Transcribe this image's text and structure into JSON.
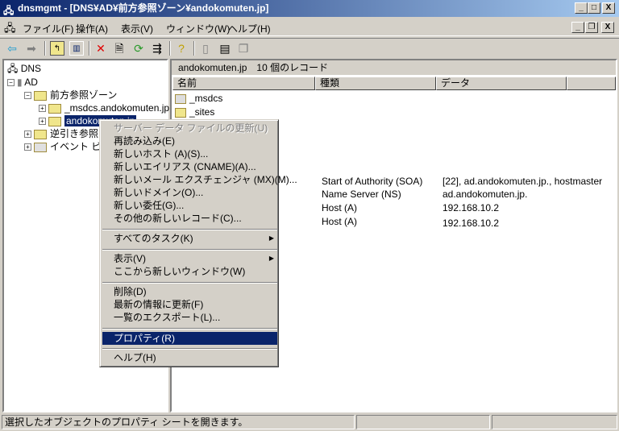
{
  "window": {
    "title": "dnsmgmt - [DNS¥AD¥前方参照ゾーン¥andokomuten.jp]",
    "minimize": "_",
    "maximize": "□",
    "close": "X",
    "mdi_min": "_",
    "mdi_restore": "❐",
    "mdi_close": "X"
  },
  "menubar": [
    "ファイル(F)",
    "操作(A)",
    "表示(V)",
    "ウィンドウ(W)",
    "ヘルプ(H)"
  ],
  "tree": {
    "root": "DNS",
    "server": "AD",
    "forward": "前方参照ゾーン",
    "zone1": "_msdcs.andokomuten.jp",
    "zone2": "andokomuten.jp",
    "reverse": "逆引き参照ゾーン",
    "events": "イベント ビューア"
  },
  "right": {
    "header": "andokomuten.jp　10 個のレコード",
    "columns": [
      "名前",
      "種類",
      "データ"
    ],
    "rows": [
      {
        "name": "_msdcs",
        "type": "",
        "data": ""
      },
      {
        "name": "_sites",
        "type": "",
        "data": ""
      },
      {
        "name": "",
        "type": "Start of Authority (SOA)",
        "data": "[22], ad.andokomuten.jp., hostmaster"
      },
      {
        "name": "",
        "type": "Name Server (NS)",
        "data": "ad.andokomuten.jp."
      },
      {
        "name": "",
        "type": "Host (A)",
        "data": "192.168.10.2"
      },
      {
        "name": "",
        "type": "Host (A)",
        "data": "192.168.10.2"
      }
    ]
  },
  "context_menu": {
    "refresh_server": "サーバー データ ファイルの更新(U)",
    "reload": "再読み込み(E)",
    "new_host": "新しいホスト (A)(S)...",
    "new_alias": "新しいエイリアス (CNAME)(A)...",
    "new_mx": "新しいメール エクスチェンジャ (MX)(M)...",
    "new_domain": "新しいドメイン(O)...",
    "new_delegation": "新しい委任(G)...",
    "other_records": "その他の新しいレコード(C)...",
    "all_tasks": "すべてのタスク(K)",
    "view": "表示(V)",
    "new_window": "ここから新しいウィンドウ(W)",
    "delete": "削除(D)",
    "refresh": "最新の情報に更新(F)",
    "export": "一覧のエクスポート(L)...",
    "properties": "プロパティ(R)",
    "help": "ヘルプ(H)"
  },
  "status": "選択したオブジェクトのプロパティ シートを開きます。"
}
